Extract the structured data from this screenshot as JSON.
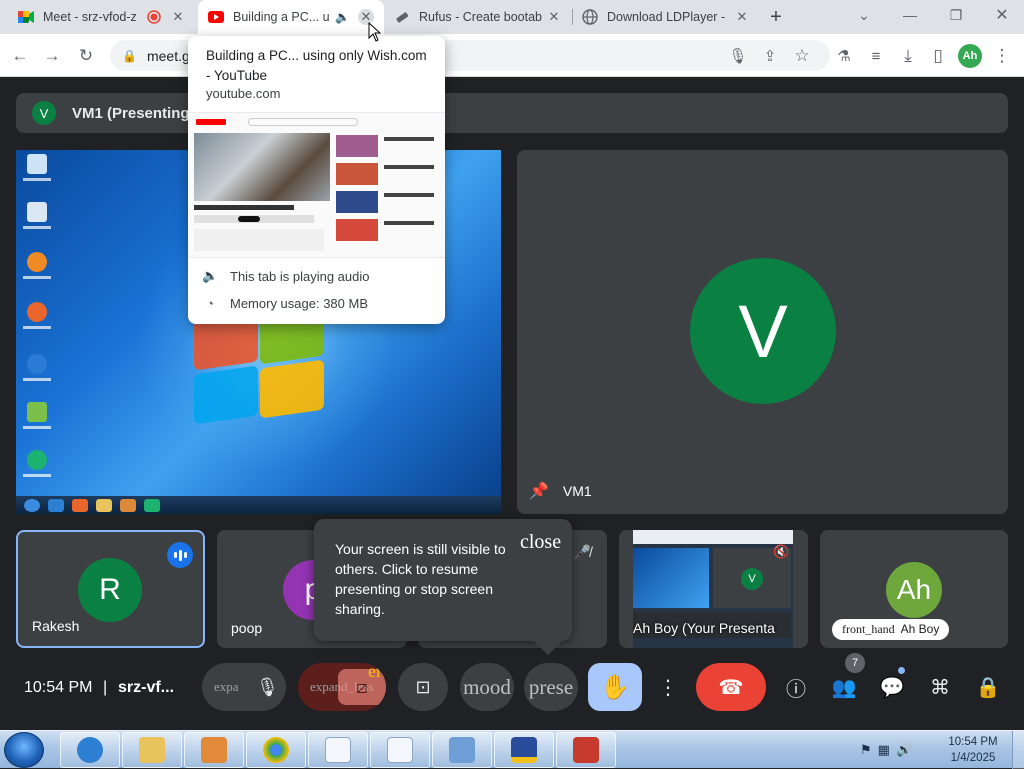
{
  "browser": {
    "tabs": [
      {
        "title": "Meet - srz-vfod-z",
        "active": false
      },
      {
        "title": "Building a PC... us",
        "active": true
      },
      {
        "title": "Rufus - Create bootab",
        "active": false
      },
      {
        "title": "Download LDPlayer - ",
        "active": false
      }
    ],
    "url": "meet.go",
    "profile_initials": "Ah"
  },
  "hover_card": {
    "title": "Building a PC... using only Wish.com - YouTube",
    "domain": "youtube.com",
    "audio_note": "This tab is playing audio",
    "memory": "Memory usage: 380 MB"
  },
  "meet": {
    "presenter_initial": "V",
    "presenting_label": "VM1 (Presenting)",
    "vm1_initial": "V",
    "vm1_label": "VM1",
    "participants": [
      {
        "name": "Rakesh",
        "initial": "R",
        "color": "#0b8043"
      },
      {
        "name": "poop",
        "initial": "p",
        "color": "#9334b3"
      },
      {
        "name": "Ah Boy (Your Presenta",
        "initial": "",
        "color": ""
      },
      {
        "name": "Ah Boy",
        "initial": "Ah",
        "color": "#6ea83d",
        "chip_prefix": "front_hand"
      }
    ],
    "screen_tip": {
      "message": "Your screen is still visible to others. Click to resume presenting or stop screen sharing.",
      "close": "close"
    },
    "controls": {
      "time": "10:54 PM",
      "separator": "|",
      "meeting_code": "srz-vf...",
      "mic_ghost": "expa",
      "cam_ghost": "expand_less",
      "cam_error": "error",
      "mood_ghost": "mood",
      "present_ghost": "prese",
      "people_count": "7"
    }
  },
  "taskbar": {
    "time": "10:54 PM",
    "date": "1/4/2025"
  },
  "colors": {
    "meet_bg": "#202124",
    "tile_bg": "#3c4043",
    "accent_blue": "#8ab4f8",
    "end_call_red": "#ea4335",
    "raise_hand_bg": "#a8c7fa"
  }
}
